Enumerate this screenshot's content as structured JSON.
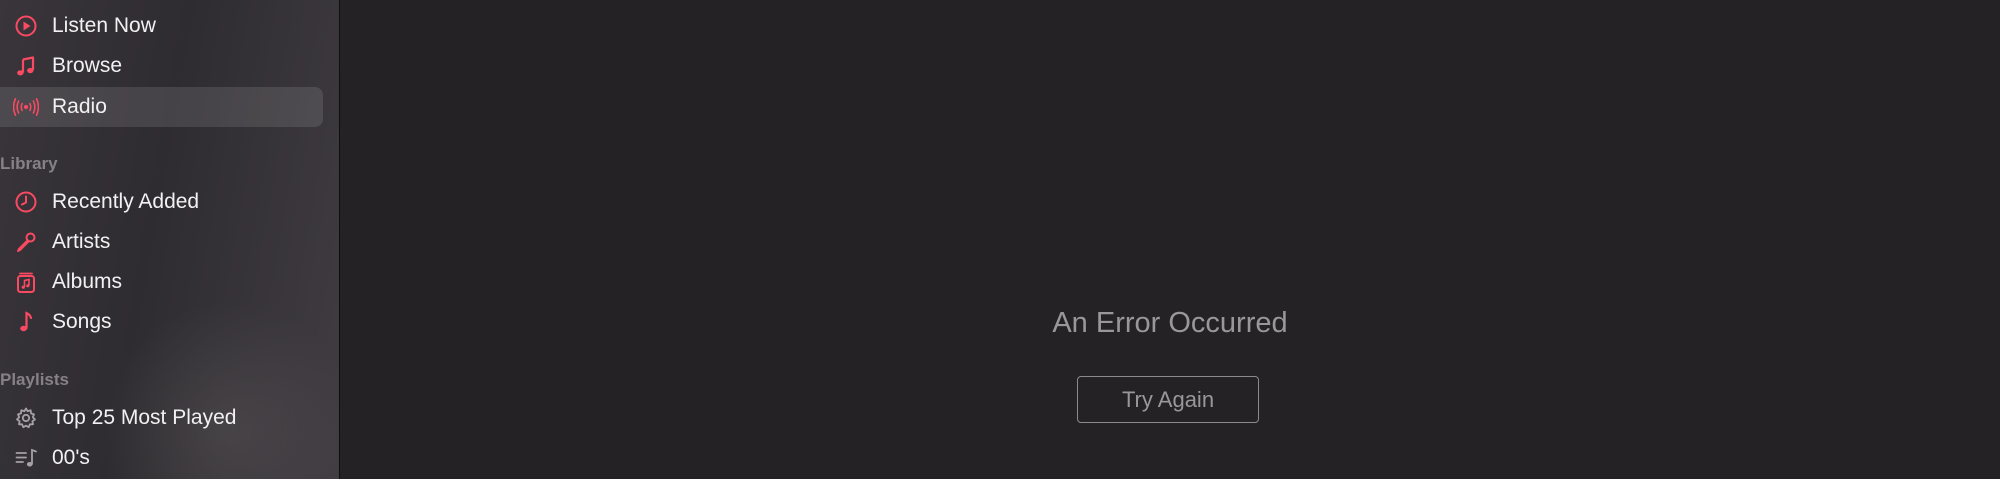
{
  "sidebar": {
    "items": [
      {
        "label": "Listen Now",
        "icon": "play-circle-icon"
      },
      {
        "label": "Browse",
        "icon": "music-note-icon"
      },
      {
        "label": "Radio",
        "icon": "radio-broadcast-icon",
        "selected": true
      }
    ],
    "library": {
      "header": "Library",
      "items": [
        {
          "label": "Recently Added",
          "icon": "clock-icon"
        },
        {
          "label": "Artists",
          "icon": "microphone-icon"
        },
        {
          "label": "Albums",
          "icon": "album-icon"
        },
        {
          "label": "Songs",
          "icon": "single-note-icon"
        }
      ]
    },
    "playlists": {
      "header": "Playlists",
      "items": [
        {
          "label": "Top 25 Most Played",
          "icon": "gear-icon"
        },
        {
          "label": "00's",
          "icon": "playlist-icon"
        }
      ]
    }
  },
  "main": {
    "error_title": "An Error Occurred",
    "try_again_label": "Try Again"
  },
  "colors": {
    "accent": "#fa4a62",
    "sidebar_text": "#f2f0f2",
    "section_header": "#858186",
    "main_background": "#252226",
    "muted_text": "#9a979b"
  }
}
